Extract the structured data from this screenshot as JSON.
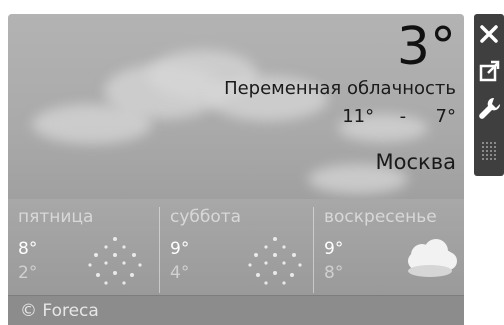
{
  "current": {
    "temperature": "3°",
    "condition": "Переменная облачность",
    "high": "11°",
    "separator": "-",
    "low": "7°",
    "city": "Москва"
  },
  "forecast": [
    {
      "day": "пятница",
      "high": "8°",
      "low": "2°",
      "icon": "snow-icon"
    },
    {
      "day": "суббота",
      "high": "9°",
      "low": "4°",
      "icon": "snow-icon"
    },
    {
      "day": "воскресенье",
      "high": "9°",
      "low": "8°",
      "icon": "cloudy-icon"
    }
  ],
  "footer": {
    "credit": "© Foreca"
  },
  "toolbar": {
    "buttons": [
      "close-icon",
      "resize-icon",
      "options-icon",
      "drag-handle-icon"
    ]
  },
  "colors": {
    "toolbar_bg": "#3f3f3f",
    "widget_bg": "#a9a9a9",
    "footer_bg": "#8c8c8c"
  }
}
